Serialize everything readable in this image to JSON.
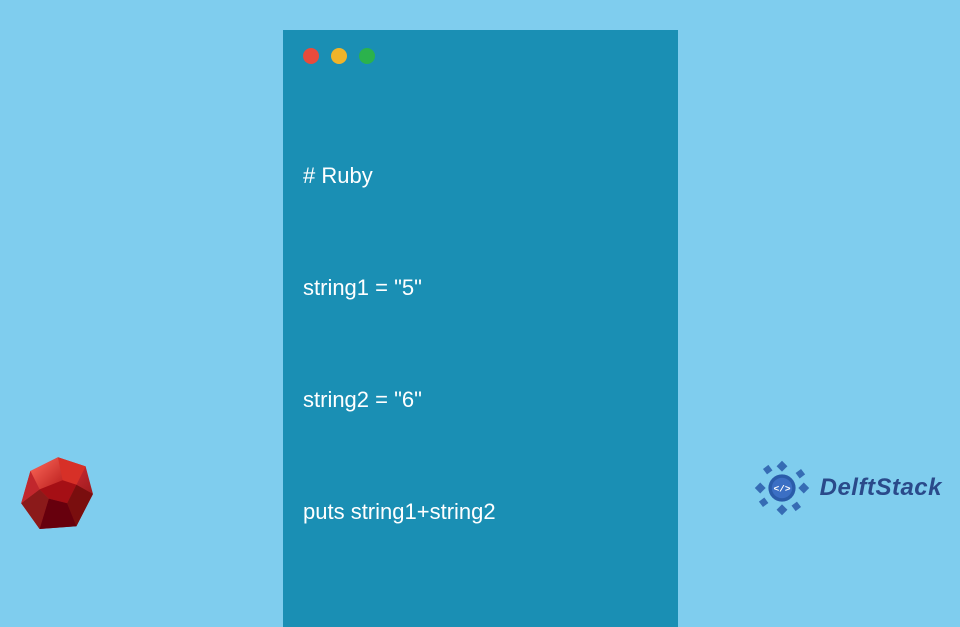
{
  "code_window": {
    "lines": [
      "# Ruby",
      "string1 = \"5\"",
      "string2 = \"6\"",
      "puts string1+string2"
    ]
  },
  "traffic_lights": {
    "red": "#e94b3c",
    "yellow": "#f0b429",
    "green": "#2bb24c"
  },
  "branding": {
    "delftstack_label": "DelftStack"
  },
  "colors": {
    "background": "#7fcdee",
    "window": "#1a8fb4",
    "code_text": "#ffffff",
    "brand_text": "#2a4a8a"
  }
}
